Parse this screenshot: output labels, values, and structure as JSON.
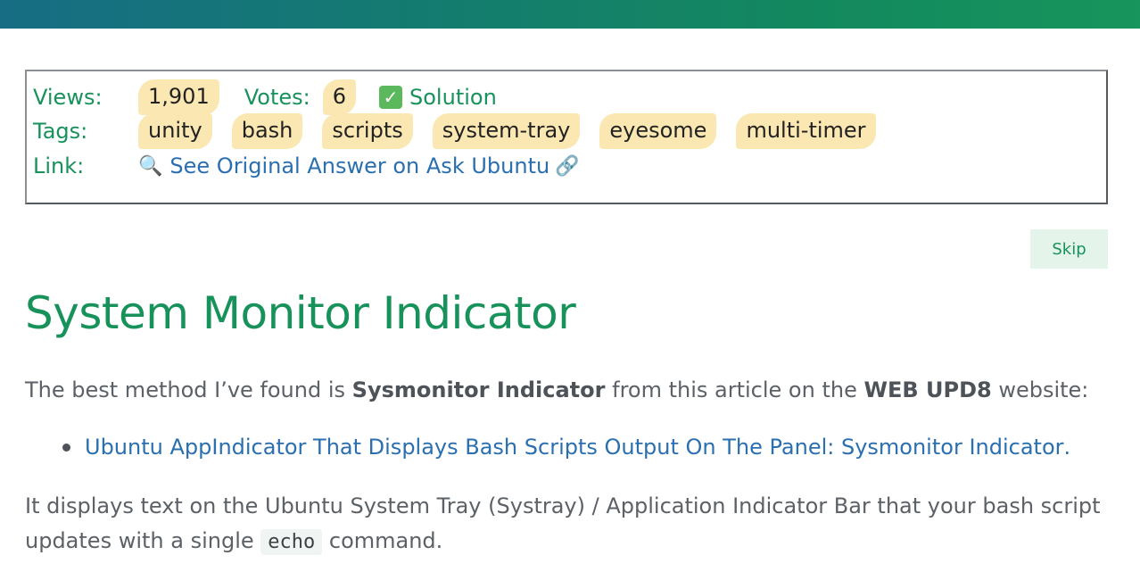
{
  "info": {
    "views_label": "Views:",
    "views_value": "1,901",
    "votes_label": "Votes:",
    "votes_value": "6",
    "solution_label": "Solution",
    "tags_label": "Tags:",
    "tags": [
      "unity",
      "bash",
      "scripts",
      "system-tray",
      "eyesome",
      "multi-timer"
    ],
    "link_label": "Link:",
    "link_text": "See Original Answer on Ask Ubuntu"
  },
  "skip_label": "Skip",
  "article": {
    "title": "System Monitor Indicator",
    "p1_a": "The best method I’ve found is ",
    "p1_b": "Sysmonitor Indicator",
    "p1_c": " from this article on the ",
    "p1_d": "WEB UPD8",
    "p1_e": " website:",
    "bullet_link": "Ubuntu AppIndicator That Displays Bash Scripts Output On The Panel: Sysmonitor Indicator",
    "bullet_end": ".",
    "p2_a": "It displays text on the Ubuntu System Tray (Systray) / Application Indicator Bar that your bash script updates with a single ",
    "p2_code": "echo",
    "p2_b": " command."
  },
  "colors": {
    "accent_green": "#18925b",
    "link_blue": "#2a6fb0",
    "tag_bg": "#fbe7b2"
  }
}
